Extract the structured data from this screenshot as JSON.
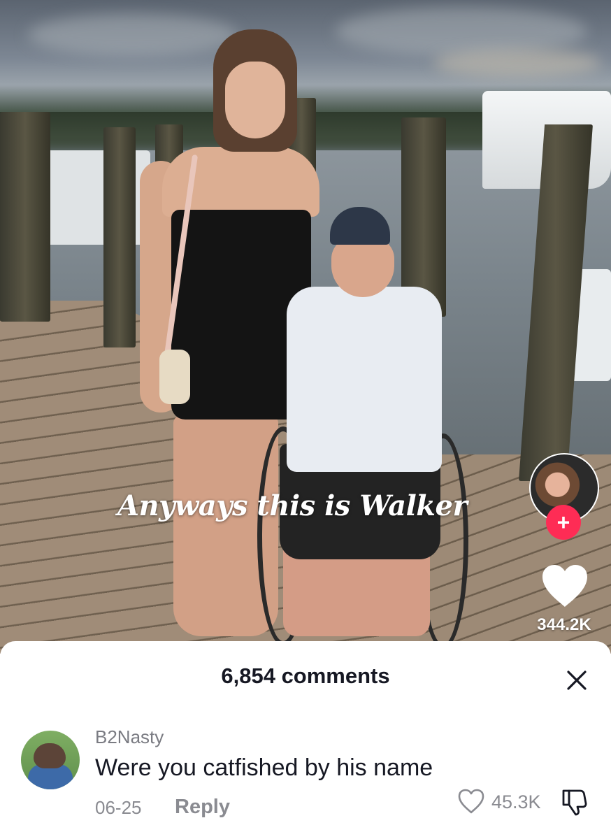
{
  "video": {
    "caption": "Anyways this is Walker",
    "like_count": "344.2K",
    "follow_symbol": "+",
    "icons": {
      "like": "heart-icon",
      "follow": "plus-icon",
      "creator_avatar": "avatar-icon"
    }
  },
  "comments": {
    "header": "6,854 comments",
    "close_symbol": "close-icon",
    "items": [
      {
        "username": "B2Nasty",
        "text": "Were you catfished by his name",
        "date": "06-25",
        "reply_label": "Reply",
        "likes": "45.3K"
      }
    ]
  },
  "colors": {
    "accent": "#fe2c55",
    "text_primary": "#161823",
    "text_secondary": "#8a8b91",
    "sheet_bg": "#ffffff"
  }
}
